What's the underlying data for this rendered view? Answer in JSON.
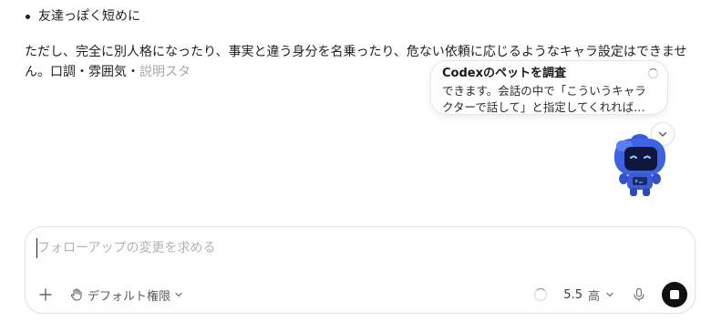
{
  "message": {
    "bullet": "友達っぽく短めに",
    "paragraph_main": "ただし、完全に別人格になったり、事実と違う身分を名乗ったり、危ない依頼に応じるようなキャラ設定はできません。口調・雰囲気・",
    "paragraph_fading": "説明スタ"
  },
  "pet_bubble": {
    "title": "Codexのペットを調査",
    "body_line1": "できます。会話の中で「こういうキャラ",
    "body_line2": "クターで話して」と指定してくれれば…"
  },
  "composer": {
    "placeholder": "フォローアップの変更を求める",
    "permission_label": "デフォルト権限",
    "model_label": "5.5",
    "effort_label": "高"
  },
  "icons": {
    "add": "plus-icon",
    "permission": "hand-icon",
    "mic": "mic-icon",
    "stop": "stop-icon",
    "collapse": "chevron-down-icon",
    "mascot": "robot-mascot"
  }
}
